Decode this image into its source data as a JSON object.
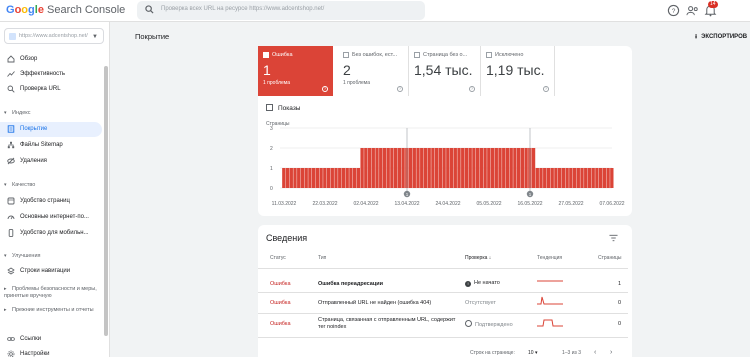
{
  "app": {
    "logo_google": "Google",
    "logo_product": "Search Console",
    "search_placeholder": "Проверка всех URL на ресурсе https://www.adcentshop.net/",
    "notification_count": "14"
  },
  "sidebar": {
    "property": "https://www.adcentshop.net/",
    "items_top": [
      {
        "label": "Обзор",
        "icon": "home-icon"
      },
      {
        "label": "Эффективность",
        "icon": "trend-icon"
      },
      {
        "label": "Проверка URL",
        "icon": "search-icon"
      }
    ],
    "section_index": "Индекс",
    "items_index": [
      {
        "label": "Покрытие",
        "icon": "document-icon"
      },
      {
        "label": "Файлы Sitemap",
        "icon": "sitemap-icon"
      },
      {
        "label": "Удаления",
        "icon": "eye-off-icon"
      }
    ],
    "section_quality": "Качество",
    "items_quality": [
      {
        "label": "Удобство страниц",
        "icon": "page-icon"
      },
      {
        "label": "Основные интернет-по...",
        "icon": "gauge-icon"
      },
      {
        "label": "Удобство для мобильн...",
        "icon": "phone-icon"
      }
    ],
    "section_improvements": "Улучшения",
    "items_improvements": [
      {
        "label": "Строки навигации",
        "icon": "layers-icon"
      }
    ],
    "section_security": "Проблемы безопасности и меры, принятые вручную",
    "section_legacy": "Прежние инструменты и отчеты",
    "items_bottom": [
      {
        "label": "Ссылки",
        "icon": "link-icon"
      },
      {
        "label": "Настройки",
        "icon": "gear-icon"
      }
    ]
  },
  "header": {
    "title": "Покрытие",
    "export_label": "ЭКСПОРТИРОВ"
  },
  "summary_tiles": [
    {
      "label": "Ошибка",
      "value": "1",
      "sub": "1 проблема",
      "selected": true
    },
    {
      "label": "Без ошибок, ест...",
      "value": "2",
      "sub": "1 проблема",
      "selected": false
    },
    {
      "label": "Страница без о...",
      "value": "1,54 тыс.",
      "sub": "",
      "selected": false
    },
    {
      "label": "Исключено",
      "value": "1,19 тыс.",
      "sub": "",
      "selected": false
    }
  ],
  "chart_toggle": "Показы",
  "chart_data": {
    "type": "bar",
    "ylabel": "Страницы",
    "ylim": [
      0,
      3
    ],
    "yticks": [
      "3",
      "2",
      "1",
      "0"
    ],
    "xticks": [
      "11.03.2022",
      "22.03.2022",
      "02.04.2022",
      "13.04.2022",
      "24.04.2022",
      "05.05.2022",
      "16.05.2022",
      "27.05.2022",
      "07.06.2022"
    ],
    "segments": [
      {
        "from": "11.03.2022",
        "to": "31.03.2022",
        "value": 1
      },
      {
        "from": "01.04.2022",
        "to": "17.05.2022",
        "value": 2
      },
      {
        "from": "18.05.2022",
        "to": "07.06.2022",
        "value": 1
      }
    ],
    "annotations": [
      {
        "date": "13.04.2022",
        "label": "1"
      },
      {
        "date": "16.05.2022",
        "label": "1"
      }
    ],
    "color": "#db4437"
  },
  "details": {
    "title": "Сведения",
    "columns": [
      "Статус",
      "Тип",
      "Проверка",
      "Тенденция",
      "Страницы"
    ],
    "rows": [
      {
        "status": "Ошибка",
        "type": "Ошибка переадресации",
        "check": "Не начато",
        "check_state": "not-started",
        "trend": "flat",
        "pages": "1"
      },
      {
        "status": "Ошибка",
        "type": "Отправленный URL не найден (ошибка 404)",
        "check": "Отсутствует",
        "check_state": "none",
        "trend": "spike",
        "pages": "0"
      },
      {
        "status": "Ошибка",
        "type": "Страница, связанная с отправленным URL, содержит тег noindex",
        "check": "Подтверждено",
        "check_state": "passed",
        "trend": "plateau",
        "pages": "0"
      }
    ],
    "rows_per_page_label": "Строк на странице:",
    "rows_per_page": "10",
    "range": "1–3 из 3"
  },
  "colors": {
    "accent": "#1a73e8",
    "error": "#db4437",
    "error_text": "#c5221f"
  }
}
